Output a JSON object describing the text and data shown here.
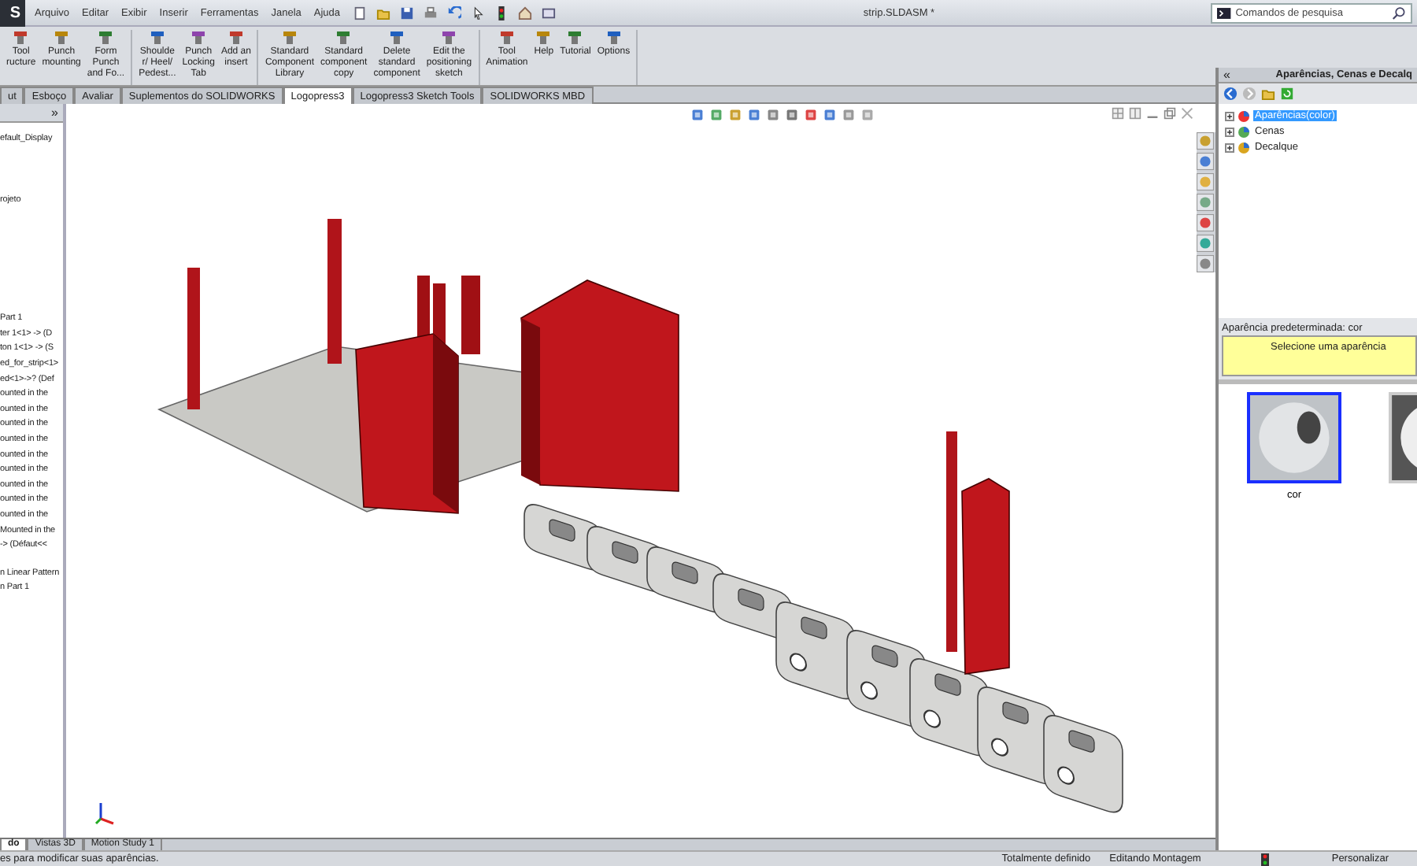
{
  "titlebar": {
    "logo": "S",
    "menu": [
      "Arquivo",
      "Editar",
      "Exibir",
      "Inserir",
      "Ferramentas",
      "Janela",
      "Ajuda"
    ],
    "title": "strip.SLDASM *",
    "search": {
      "placeholder": "Comandos de pesquisa"
    }
  },
  "ribbon": {
    "groups": [
      [
        {
          "label": "Tool\nructure"
        },
        {
          "label": "Punch\nmounting"
        },
        {
          "label": "Form\nPunch\nand Fo..."
        }
      ],
      [
        {
          "label": "Shoulde\nr/ Heel/\nPedest..."
        },
        {
          "label": "Punch\nLocking\nTab"
        },
        {
          "label": "Add an\ninsert"
        }
      ],
      [
        {
          "label": "Standard\nComponent\nLibrary"
        },
        {
          "label": "Standard\ncomponent\ncopy"
        },
        {
          "label": "Delete\nstandard\ncomponent"
        },
        {
          "label": "Edit the\npositioning\nsketch"
        }
      ],
      [
        {
          "label": "Tool\nAnimation"
        },
        {
          "label": "Help"
        },
        {
          "label": "Tutorial"
        },
        {
          "label": "Options"
        }
      ]
    ]
  },
  "command_tabs": [
    {
      "label": "ut",
      "selected": false
    },
    {
      "label": "Esboço",
      "selected": false
    },
    {
      "label": "Avaliar",
      "selected": false
    },
    {
      "label": "Suplementos do SOLIDWORKS",
      "selected": false
    },
    {
      "label": "Logopress3",
      "selected": true
    },
    {
      "label": "Logopress3 Sketch Tools",
      "selected": false
    },
    {
      "label": "SOLIDWORKS MBD",
      "selected": false
    }
  ],
  "feature_tree": {
    "expand": "»",
    "groups": [
      [
        "efault_Display"
      ],
      [
        "rojeto"
      ],
      [
        "Part 1",
        "ter 1<1> -> (D",
        "ton 1<1> -> (S",
        "ed_for_strip<1>",
        "ed<1>->? (Def",
        "ounted in the",
        "ounted in the",
        "ounted in the",
        "ounted in the",
        "ounted in the",
        "ounted in the",
        "ounted in the",
        "ounted in the",
        "ounted in the",
        "Mounted in the",
        "-> (Défaut<<"
      ],
      [
        "n Linear Pattern",
        "n  Part 1"
      ]
    ]
  },
  "task_pane": {
    "collapse": "«",
    "title": "Aparências, Cenas e Decalq",
    "tree": [
      {
        "label": "Aparências(color)",
        "selected": true
      },
      {
        "label": "Cenas",
        "selected": false
      },
      {
        "label": "Decalque",
        "selected": false
      }
    ],
    "default_label": "Aparência predeterminada: cor",
    "message": "Selecione uma aparência",
    "swatches": [
      {
        "label": "cor",
        "selected": true
      },
      {
        "selected": false
      }
    ]
  },
  "bottom_tabs": [
    {
      "label": "do",
      "selected": true
    },
    {
      "label": "Vistas 3D",
      "selected": false
    },
    {
      "label": "Motion Study 1",
      "selected": false
    }
  ],
  "status_bar": {
    "message": "es para modificar suas aparências.",
    "state": "Totalmente definido",
    "mode": "Editando Montagem",
    "customize": "Personalizar"
  }
}
